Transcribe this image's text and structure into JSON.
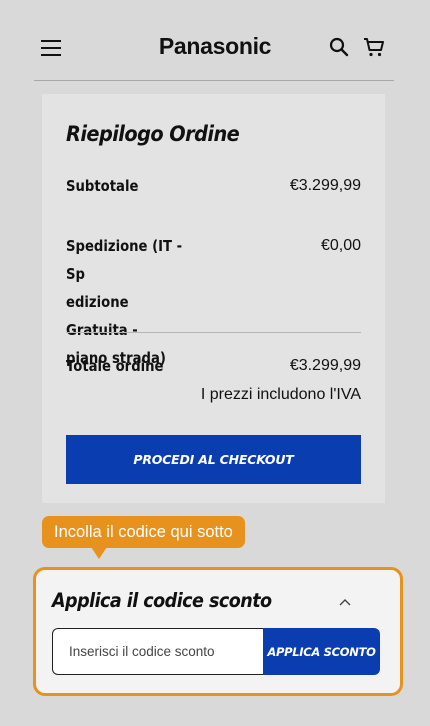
{
  "header": {
    "brand": "Panasonic",
    "icons": [
      "menu-icon",
      "search-icon",
      "cart-icon"
    ]
  },
  "summary": {
    "title": "Riepilogo Ordine",
    "subtotal_label": "Subtotale",
    "subtotal_value": "€3.299,99",
    "shipping_label": "Spedizione (IT - Sp edizione Gratuita - piano strada)",
    "shipping_lines": [
      "Spedizione (IT - Sp",
      "edizione Gratuita -",
      "piano strada)"
    ],
    "shipping_value": "€0,00",
    "total_label": "Totale ordine",
    "total_value": "€3.299,99",
    "vat_note": "I prezzi includono l'IVA",
    "checkout_label": "PROCEDI AL CHECKOUT"
  },
  "tooltip": {
    "text": "Incolla il codice qui sotto"
  },
  "discount": {
    "title": "Applica il codice sconto",
    "input_placeholder": "Inserisci il codice sconto",
    "input_value": "",
    "apply_label": "APPLICA SCONTO"
  },
  "colors": {
    "accent_blue": "#0a3eb0",
    "highlight_orange": "#e8921e",
    "background": "#d9d9d9",
    "panel": "#e3e3e3"
  }
}
